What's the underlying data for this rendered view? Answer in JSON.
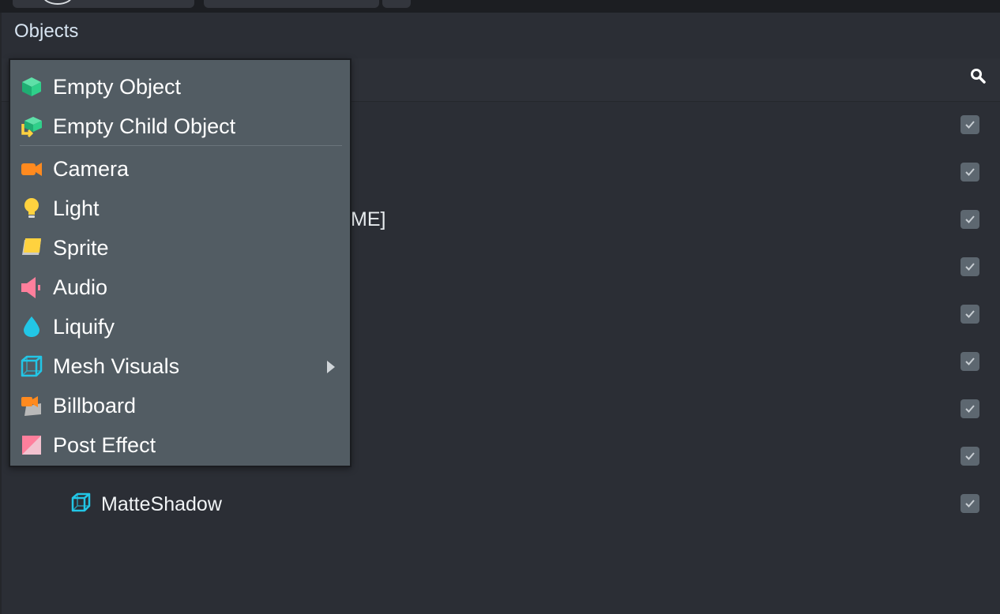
{
  "panel": {
    "title": "Objects",
    "partial_item_text": "ME]",
    "tree_item_label": "MatteShadow"
  },
  "menu": {
    "items": [
      {
        "label": "Empty Object",
        "icon": "empty-object-icon"
      },
      {
        "label": "Empty Child Object",
        "icon": "empty-child-object-icon"
      },
      {
        "label": "Camera",
        "icon": "camera-icon"
      },
      {
        "label": "Light",
        "icon": "light-bulb-icon"
      },
      {
        "label": "Sprite",
        "icon": "sprite-icon"
      },
      {
        "label": "Audio",
        "icon": "audio-speaker-icon"
      },
      {
        "label": "Liquify",
        "icon": "liquify-drop-icon"
      },
      {
        "label": "Mesh Visuals",
        "icon": "mesh-cube-icon",
        "has_submenu": true
      },
      {
        "label": "Billboard",
        "icon": "billboard-icon"
      },
      {
        "label": "Post Effect",
        "icon": "post-effect-icon"
      }
    ]
  },
  "colors": {
    "panel_bg": "#2b2e35",
    "menu_bg": "#525c63",
    "green_accent": "#2fd08a",
    "orange_accent": "#ff8a1f",
    "yellow_accent": "#ffd23f",
    "pink_accent": "#ff7f9c",
    "cyan_accent": "#22c6e6",
    "checkbox_bg": "#5d6770"
  }
}
